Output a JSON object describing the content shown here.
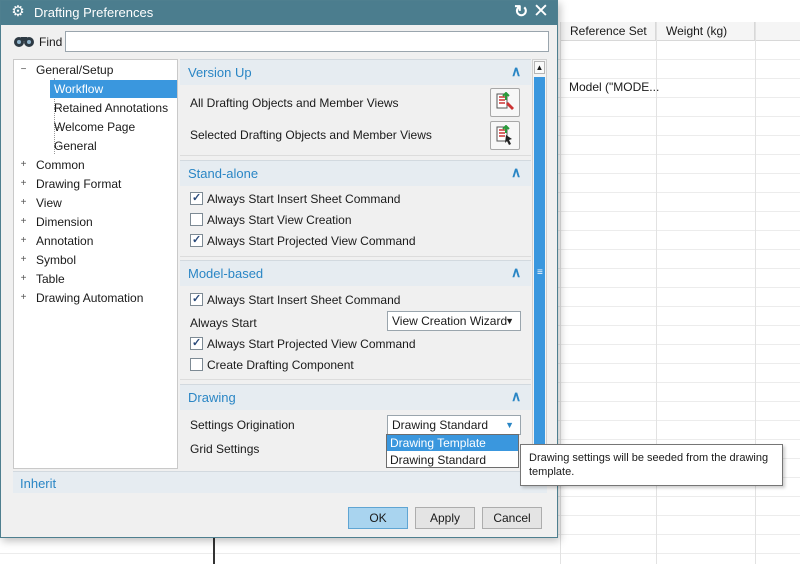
{
  "background": {
    "columns": [
      "Reference Set",
      "Weight (kg)"
    ],
    "cell": "Model (\"MODE..."
  },
  "dialog": {
    "title": "Drafting Preferences",
    "find_label": "Find",
    "find_value": ""
  },
  "tree": {
    "nodes": [
      {
        "label": "General/Setup",
        "toggle": "−"
      },
      {
        "label": "Workflow"
      },
      {
        "label": "Retained Annotations"
      },
      {
        "label": "Welcome Page"
      },
      {
        "label": "General"
      },
      {
        "label": "Common",
        "toggle": "+"
      },
      {
        "label": "Drawing Format",
        "toggle": "+"
      },
      {
        "label": "View",
        "toggle": "+"
      },
      {
        "label": "Dimension",
        "toggle": "+"
      },
      {
        "label": "Annotation",
        "toggle": "+"
      },
      {
        "label": "Symbol",
        "toggle": "+"
      },
      {
        "label": "Table",
        "toggle": "+"
      },
      {
        "label": "Drawing Automation",
        "toggle": "+"
      }
    ],
    "selected": "Workflow"
  },
  "sections": {
    "version_up": {
      "title": "Version Up",
      "row1": "All Drafting Objects and Member Views",
      "row2": "Selected Drafting Objects and Member Views"
    },
    "standalone": {
      "title": "Stand-alone",
      "opt1": "Always Start Insert Sheet Command",
      "opt2": "Always Start View Creation",
      "opt3": "Always Start Projected View Command",
      "checked": [
        true,
        false,
        true
      ]
    },
    "model_based": {
      "title": "Model-based",
      "opt1": "Always Start Insert Sheet Command",
      "always_start_label": "Always Start",
      "always_start_value": "View Creation Wizard",
      "opt2": "Always Start Projected View Command",
      "opt3": "Create Drafting Component",
      "checked": [
        true,
        true,
        false
      ]
    },
    "drawing": {
      "title": "Drawing",
      "settings_origination_label": "Settings Origination",
      "settings_origination_value": "Drawing Standard",
      "grid_settings_label": "Grid Settings",
      "dropdown_options": [
        "Drawing Template",
        "Drawing Standard"
      ],
      "highlighted_option": "Drawing Template"
    }
  },
  "inherit_label": "Inherit",
  "buttons": {
    "ok": "OK",
    "apply": "Apply",
    "cancel": "Cancel"
  },
  "tooltip": "Drawing settings will be seeded from the drawing template.",
  "colors": {
    "titlebar": "#4b7d8e",
    "accent": "#2a86c5",
    "selection": "#3a97de",
    "ok_button": "#a9d4ef"
  }
}
